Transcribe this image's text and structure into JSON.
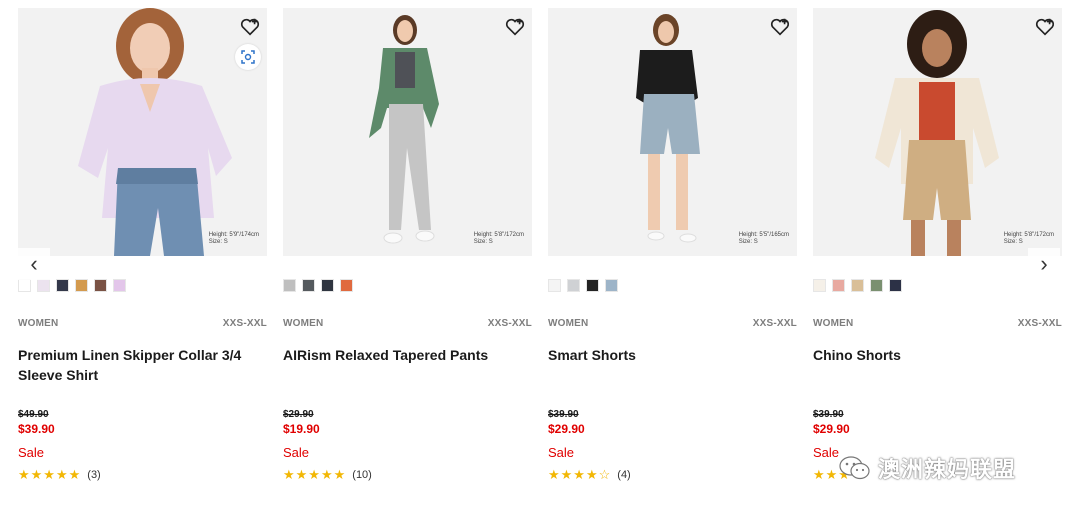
{
  "carousel": {
    "prev_label": "‹",
    "next_label": "›"
  },
  "products": [
    {
      "gender": "WOMEN",
      "sizes": "XXS-XXL",
      "name": "Premium Linen Skipper Collar 3/4 Sleeve Shirt",
      "original_price": "$49.90",
      "sale_price": "$39.90",
      "sale_label": "Sale",
      "stars": "★★★★★",
      "review_count": "(3)",
      "model_height": "Height: 5'9\"/174cm",
      "model_size": "Size: S",
      "swatches": [
        "#ffffff",
        "#ece3ef",
        "#33384a",
        "#d39a4e",
        "#7a5244",
        "#e3c6ea"
      ]
    },
    {
      "gender": "WOMEN",
      "sizes": "XXS-XXL",
      "name": "AIRism Relaxed Tapered Pants",
      "original_price": "$29.90",
      "sale_price": "$19.90",
      "sale_label": "Sale",
      "stars": "★★★★★",
      "review_count": "(10)",
      "model_height": "Height: 5'8\"/172cm",
      "model_size": "Size: S",
      "swatches": [
        "#bfbfbf",
        "#555a5e",
        "#2f3540",
        "#e06a3f"
      ]
    },
    {
      "gender": "WOMEN",
      "sizes": "XXS-XXL",
      "name": "Smart Shorts",
      "original_price": "$39.90",
      "sale_price": "$29.90",
      "sale_label": "Sale",
      "stars": "★★★★☆",
      "review_count": "(4)",
      "model_height": "Height: 5'5\"/165cm",
      "model_size": "Size: S",
      "swatches": [
        "#f4f4f4",
        "#cfd1d4",
        "#232323",
        "#9db4c8"
      ]
    },
    {
      "gender": "WOMEN",
      "sizes": "XXS-XXL",
      "name": "Chino Shorts",
      "original_price": "$39.90",
      "sale_price": "$29.90",
      "sale_label": "Sale",
      "stars": "★★★",
      "review_count": "",
      "model_height": "Height: 5'8\"/172cm",
      "model_size": "Size: S",
      "swatches": [
        "#f5f0e8",
        "#e8a9a0",
        "#d9bf98",
        "#7a9070",
        "#2c3146"
      ]
    }
  ],
  "watermark": {
    "text": "澳洲辣妈联盟",
    "icon": "wechat-icon"
  },
  "colors": {
    "sale_red": "#e00000",
    "star_gold": "#f2b705",
    "meta_gray": "#7d7d7d"
  }
}
